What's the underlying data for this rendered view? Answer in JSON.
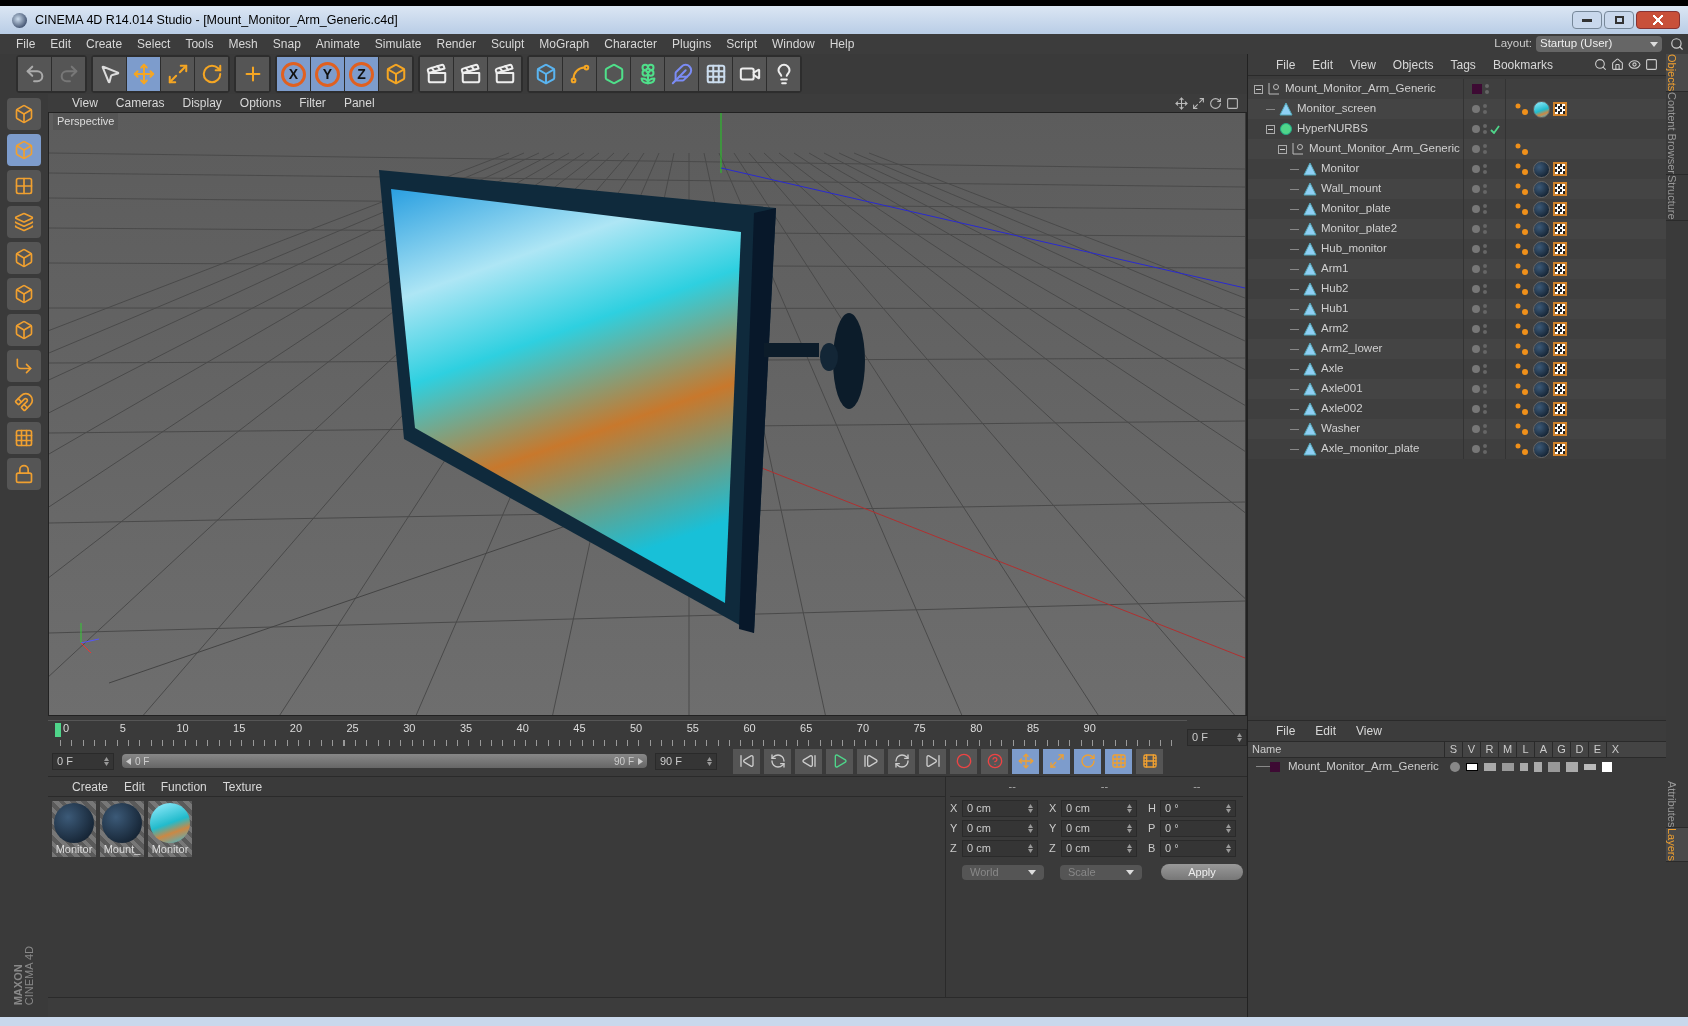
{
  "window": {
    "title": "CINEMA 4D R14.014 Studio - [Mount_Monitor_Arm_Generic.c4d]"
  },
  "menu": [
    "File",
    "Edit",
    "Create",
    "Select",
    "Tools",
    "Mesh",
    "Snap",
    "Animate",
    "Simulate",
    "Render",
    "Sculpt",
    "MoGraph",
    "Character",
    "Plugins",
    "Script",
    "Window",
    "Help"
  ],
  "layout": {
    "label": "Layout:",
    "value": "Startup (User)"
  },
  "toolbar": [
    {
      "kind": "undo",
      "selected": false
    },
    {
      "kind": "redo",
      "selected": false
    },
    {
      "kind": "select",
      "selected": false
    },
    {
      "kind": "move",
      "selected": true
    },
    {
      "kind": "scale",
      "selected": false
    },
    {
      "kind": "rotate",
      "selected": false
    },
    {
      "kind": "add",
      "selected": false
    },
    {
      "kind": "axis",
      "label": "X",
      "selected": true
    },
    {
      "kind": "axis",
      "label": "Y",
      "selected": true
    },
    {
      "kind": "axis",
      "label": "Z",
      "selected": true
    },
    {
      "kind": "coords",
      "selected": false
    },
    {
      "kind": "render",
      "selected": false
    },
    {
      "kind": "render",
      "selected": false
    },
    {
      "kind": "render",
      "selected": false
    },
    {
      "kind": "cube",
      "selected": false
    },
    {
      "kind": "spline",
      "selected": false
    },
    {
      "kind": "nurbs",
      "selected": false
    },
    {
      "kind": "array",
      "selected": false
    },
    {
      "kind": "deformer",
      "selected": false
    },
    {
      "kind": "floor",
      "selected": false
    },
    {
      "kind": "camera",
      "selected": false
    },
    {
      "kind": "light",
      "selected": false
    }
  ],
  "left_tools": [
    {
      "kind": "editable",
      "selected": false
    },
    {
      "kind": "model",
      "selected": true
    },
    {
      "kind": "texture",
      "selected": false
    },
    {
      "kind": "workplane",
      "selected": false
    },
    {
      "kind": "points",
      "selected": false
    },
    {
      "kind": "edges",
      "selected": false
    },
    {
      "kind": "polygons",
      "selected": false
    },
    {
      "kind": "axis",
      "selected": false
    },
    {
      "kind": "magnet",
      "selected": false
    },
    {
      "kind": "grid",
      "selected": false
    },
    {
      "kind": "lock",
      "selected": false
    }
  ],
  "logo": [
    "MAXON",
    "CINEMA 4D"
  ],
  "viewport": {
    "menu": [
      "View",
      "Cameras",
      "Display",
      "Options",
      "Filter",
      "Panel"
    ],
    "label": "Perspective"
  },
  "objects": {
    "menu": [
      "File",
      "Edit",
      "View",
      "Objects",
      "Tags",
      "Bookmarks"
    ],
    "tree": [
      {
        "name": "Mount_Monitor_Arm_Generic",
        "kind": "null",
        "expanded": true,
        "color": "#3d0a33",
        "children": [
          {
            "name": "Monitor_screen",
            "kind": "polygon",
            "tags": [
              {
                "kind": "phong"
              },
              {
                "kind": "screen"
              },
              {
                "kind": "uvw"
              }
            ]
          },
          {
            "name": "HyperNURBS",
            "kind": "nurbs",
            "expanded": true,
            "enabled": true,
            "children": [
              {
                "name": "Mount_Monitor_Arm_Generic",
                "kind": "null",
                "expanded": true,
                "tags": [
                  {
                    "kind": "phong"
                  }
                ],
                "children": [
                  {
                    "name": "Monitor",
                    "kind": "polygon",
                    "tags": [
                      {
                        "kind": "phong"
                      },
                      {
                        "kind": "dark"
                      },
                      {
                        "kind": "uvw"
                      }
                    ]
                  },
                  {
                    "name": "Wall_mount",
                    "kind": "polygon",
                    "tags": [
                      {
                        "kind": "phong"
                      },
                      {
                        "kind": "dark"
                      },
                      {
                        "kind": "uvw"
                      }
                    ]
                  },
                  {
                    "name": "Monitor_plate",
                    "kind": "polygon",
                    "tags": [
                      {
                        "kind": "phong"
                      },
                      {
                        "kind": "dark"
                      },
                      {
                        "kind": "uvw"
                      }
                    ]
                  },
                  {
                    "name": "Monitor_plate2",
                    "kind": "polygon",
                    "tags": [
                      {
                        "kind": "phong"
                      },
                      {
                        "kind": "dark"
                      },
                      {
                        "kind": "uvw"
                      }
                    ]
                  },
                  {
                    "name": "Hub_monitor",
                    "kind": "polygon",
                    "tags": [
                      {
                        "kind": "phong"
                      },
                      {
                        "kind": "dark"
                      },
                      {
                        "kind": "uvw"
                      }
                    ]
                  },
                  {
                    "name": "Arm1",
                    "kind": "polygon",
                    "tags": [
                      {
                        "kind": "phong"
                      },
                      {
                        "kind": "dark"
                      },
                      {
                        "kind": "uvw"
                      }
                    ]
                  },
                  {
                    "name": "Hub2",
                    "kind": "polygon",
                    "tags": [
                      {
                        "kind": "phong"
                      },
                      {
                        "kind": "dark"
                      },
                      {
                        "kind": "uvw"
                      }
                    ]
                  },
                  {
                    "name": "Hub1",
                    "kind": "polygon",
                    "tags": [
                      {
                        "kind": "phong"
                      },
                      {
                        "kind": "dark"
                      },
                      {
                        "kind": "uvw"
                      }
                    ]
                  },
                  {
                    "name": "Arm2",
                    "kind": "polygon",
                    "tags": [
                      {
                        "kind": "phong"
                      },
                      {
                        "kind": "dark"
                      },
                      {
                        "kind": "uvw"
                      }
                    ]
                  },
                  {
                    "name": "Arm2_lower",
                    "kind": "polygon",
                    "tags": [
                      {
                        "kind": "phong"
                      },
                      {
                        "kind": "dark"
                      },
                      {
                        "kind": "uvw"
                      }
                    ]
                  },
                  {
                    "name": "Axle",
                    "kind": "polygon",
                    "tags": [
                      {
                        "kind": "phong"
                      },
                      {
                        "kind": "dark"
                      },
                      {
                        "kind": "uvw"
                      }
                    ]
                  },
                  {
                    "name": "Axle001",
                    "kind": "polygon",
                    "tags": [
                      {
                        "kind": "phong"
                      },
                      {
                        "kind": "dark"
                      },
                      {
                        "kind": "uvw"
                      }
                    ]
                  },
                  {
                    "name": "Axle002",
                    "kind": "polygon",
                    "tags": [
                      {
                        "kind": "phong"
                      },
                      {
                        "kind": "dark"
                      },
                      {
                        "kind": "uvw"
                      }
                    ]
                  },
                  {
                    "name": "Washer",
                    "kind": "polygon",
                    "tags": [
                      {
                        "kind": "phong"
                      },
                      {
                        "kind": "dark"
                      },
                      {
                        "kind": "uvw"
                      }
                    ]
                  },
                  {
                    "name": "Axle_monitor_plate",
                    "kind": "polygon",
                    "tags": [
                      {
                        "kind": "phong"
                      },
                      {
                        "kind": "dark"
                      },
                      {
                        "kind": "uvw"
                      }
                    ]
                  }
                ]
              }
            ]
          }
        ]
      }
    ]
  },
  "side_tabs_top": [
    {
      "label": "Objects",
      "selected": true
    },
    {
      "label": "Content Browser",
      "selected": false
    },
    {
      "label": "Structure",
      "selected": false
    }
  ],
  "side_tabs_bottom": [
    {
      "label": "Attributes",
      "selected": false
    },
    {
      "label": "Layers",
      "selected": true
    }
  ],
  "timeline": {
    "ticks": [
      "0",
      "5",
      "10",
      "15",
      "20",
      "25",
      "30",
      "35",
      "40",
      "45",
      "50",
      "55",
      "60",
      "65",
      "70",
      "75",
      "80",
      "85",
      "90"
    ],
    "playhead": {
      "level": 0
    },
    "range_fill": {
      "level": 1
    },
    "current": "0 F",
    "start": "0 F",
    "range_start": "0 F",
    "range_end": "90 F",
    "end": "90 F"
  },
  "materials": {
    "menu": [
      "Create",
      "Edit",
      "Function",
      "Texture"
    ],
    "items": [
      {
        "name": "Monitor",
        "kind": "dark"
      },
      {
        "name": "Mount_",
        "kind": "dark"
      },
      {
        "name": "Monitor",
        "kind": "screen"
      }
    ]
  },
  "coordinates": {
    "headers": [
      "--",
      "--",
      "--"
    ],
    "rows": [
      [
        {
          "axis": "X",
          "value": "0 cm"
        },
        {
          "axis": "X",
          "value": "0 cm"
        },
        {
          "axis": "H",
          "value": "0 °"
        }
      ],
      [
        {
          "axis": "Y",
          "value": "0 cm"
        },
        {
          "axis": "Y",
          "value": "0 cm"
        },
        {
          "axis": "P",
          "value": "0 °"
        }
      ],
      [
        {
          "axis": "Z",
          "value": "0 cm"
        },
        {
          "axis": "Z",
          "value": "0 cm"
        },
        {
          "axis": "B",
          "value": "0 °"
        }
      ]
    ],
    "space": "World",
    "mode": "Scale",
    "apply": "Apply"
  },
  "layers": {
    "menu": [
      "File",
      "Edit",
      "View"
    ],
    "name_header": "Name",
    "columns": [
      "S",
      "V",
      "R",
      "M",
      "L",
      "A",
      "G",
      "D",
      "E",
      "X"
    ],
    "rows": [
      {
        "name": "Mount_Monitor_Arm_Generic",
        "color": "#3d0a33"
      }
    ]
  }
}
